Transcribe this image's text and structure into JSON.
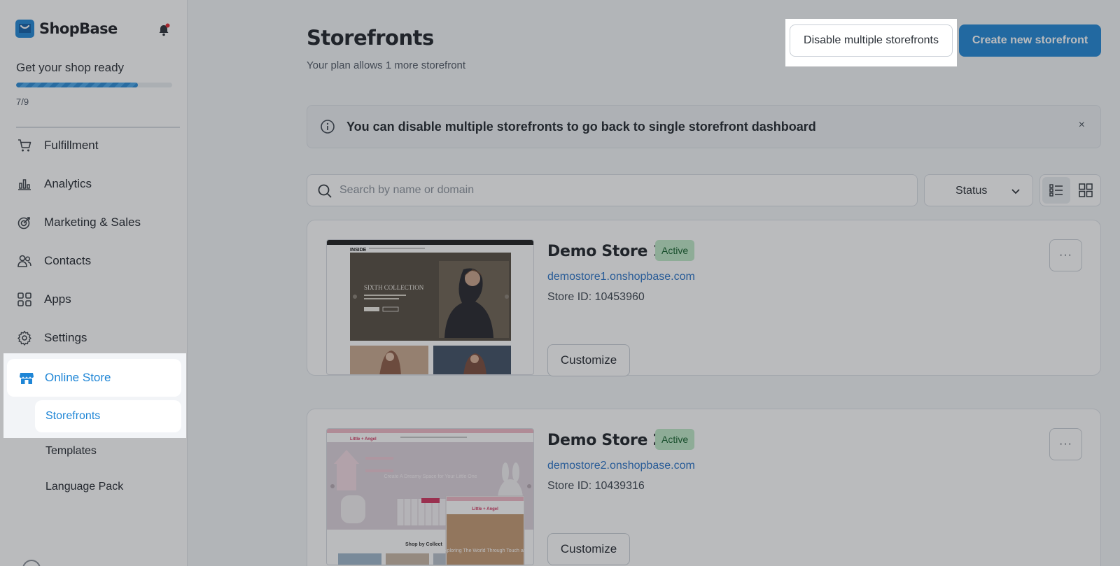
{
  "brand": {
    "name": "ShopBase"
  },
  "setup": {
    "title": "Get your shop ready",
    "count": "7/9",
    "progress": 0.78
  },
  "nav": {
    "items": [
      {
        "label": "Fulfillment",
        "icon": "cart-icon"
      },
      {
        "label": "Analytics",
        "icon": "bar-chart-icon"
      },
      {
        "label": "Marketing & Sales",
        "icon": "target-icon"
      },
      {
        "label": "Contacts",
        "icon": "users-icon"
      },
      {
        "label": "Apps",
        "icon": "apps-grid-icon"
      },
      {
        "label": "Settings",
        "icon": "gear-icon"
      }
    ],
    "active": {
      "label": "Online Store",
      "icon": "store-icon"
    },
    "sub_items": [
      {
        "label": "Storefronts",
        "active": true
      },
      {
        "label": "Templates",
        "active": false
      },
      {
        "label": "Language Pack",
        "active": false
      }
    ]
  },
  "header": {
    "title": "Storefronts",
    "subtitle": "Your plan allows 1 more storefront",
    "disable_label": "Disable multiple storefronts",
    "create_label": "Create new storefront"
  },
  "banner": {
    "text": "You can disable multiple storefronts to go back to single storefront dashboard",
    "close": "×"
  },
  "filters": {
    "search_placeholder": "Search by name or domain",
    "status_label": "Status"
  },
  "stores": [
    {
      "name": "Demo Store 1",
      "status": "Active",
      "domain": "demostore1.onshopbase.com",
      "store_id": "Store ID: 10453960",
      "customize_label": "Customize",
      "more_label": "···",
      "thumb": {
        "logo": "INSIDE",
        "headline": "SIXTH COLLECTION"
      }
    },
    {
      "name": "Demo Store 2",
      "status": "Active",
      "domain": "demostore2.onshopbase.com",
      "store_id": "Store ID: 10439316",
      "customize_label": "Customize",
      "more_label": "···",
      "thumb": {
        "logo": "Little + Angel",
        "headline": "Create A Dreamy Space for Your Little One",
        "section": "Shop by Collect",
        "mobile_headline": "Exploring The World Through Touch and"
      }
    }
  ],
  "colors": {
    "accent": "#1f86d6",
    "badge_bg": "#bfe9c8",
    "badge_text": "#13612c",
    "link": "#2a73c8"
  }
}
